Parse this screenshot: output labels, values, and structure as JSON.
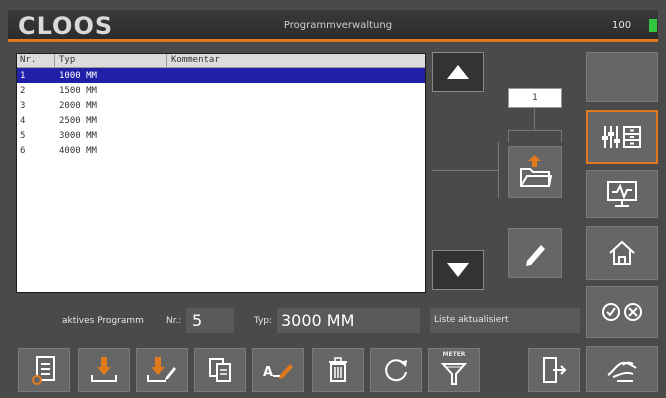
{
  "header": {
    "logo": "CLOOS",
    "title": "Programmverwaltung",
    "level": "100",
    "indicator_color": "#30c640"
  },
  "table": {
    "headers": [
      "Nr.",
      "Typ",
      "Kommentar"
    ],
    "rows": [
      {
        "nr": "1",
        "typ": "1000 MM",
        "kommentar": ""
      },
      {
        "nr": "2",
        "typ": "1500 MM",
        "kommentar": ""
      },
      {
        "nr": "3",
        "typ": "2000 MM",
        "kommentar": ""
      },
      {
        "nr": "4",
        "typ": "2500 MM",
        "kommentar": ""
      },
      {
        "nr": "5",
        "typ": "3000 MM",
        "kommentar": ""
      },
      {
        "nr": "6",
        "typ": "4000 MM",
        "kommentar": ""
      }
    ],
    "selected_index": 0,
    "selection_color": "#2020a8"
  },
  "navigator": {
    "page": "1"
  },
  "status": {
    "active_program_label": "aktives Programm",
    "nr_label": "Nr.:",
    "nr_value": "5",
    "typ_label": "Typ:",
    "typ_value": "3000 MM",
    "message": "Liste aktualisiert"
  },
  "toolbar": {
    "icons": [
      "document-circle-icon",
      "download-icon",
      "download-edit-icon",
      "copy-icon",
      "rename-icon",
      "trash-icon",
      "refresh-icon",
      "meter-filter-icon",
      "exit-icon"
    ],
    "meter_label": "METER"
  },
  "sidebar": {
    "icons": [
      "blank-tile",
      "program-manager-icon",
      "monitor-icon",
      "home-icon",
      "confirm-cancel-icon",
      "hand-icon"
    ]
  },
  "accent_color": "#e07a1c"
}
